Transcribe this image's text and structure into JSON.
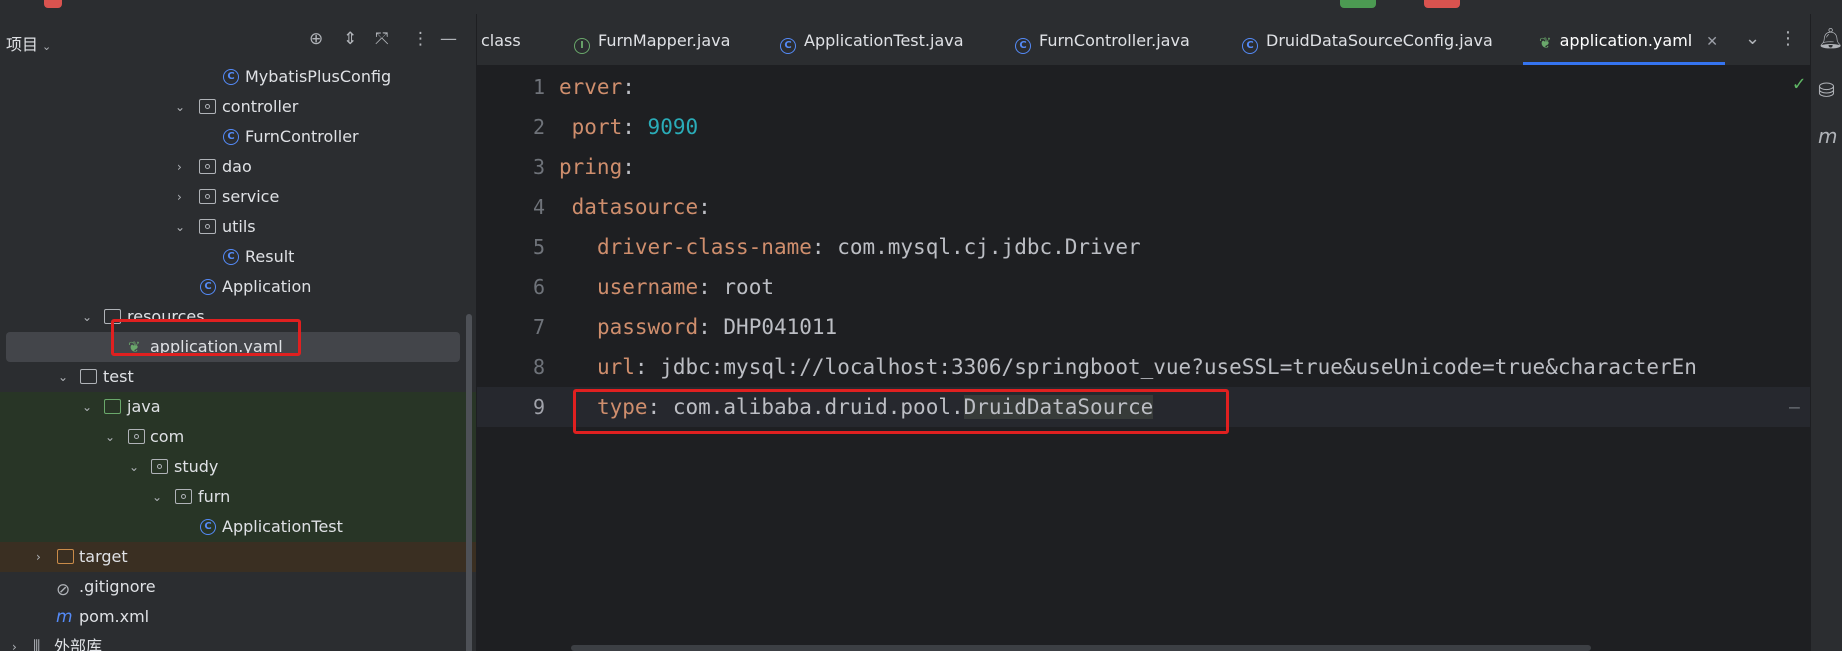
{
  "project_panel": {
    "title": "项目",
    "tree": [
      {
        "label": "MybatisPlusConfig",
        "type": "class"
      },
      {
        "label": "controller",
        "type": "package",
        "expanded": true
      },
      {
        "label": "FurnController",
        "type": "class"
      },
      {
        "label": "dao",
        "type": "package",
        "expanded": false
      },
      {
        "label": "service",
        "type": "package",
        "expanded": false
      },
      {
        "label": "utils",
        "type": "package",
        "expanded": true
      },
      {
        "label": "Result",
        "type": "class"
      },
      {
        "label": "Application",
        "type": "spring-class"
      },
      {
        "label": "resources",
        "type": "resources-folder",
        "expanded": true
      },
      {
        "label": "application.yaml",
        "type": "yaml",
        "selected": true
      },
      {
        "label": "test",
        "type": "folder",
        "expanded": true
      },
      {
        "label": "java",
        "type": "test-source-folder",
        "expanded": true
      },
      {
        "label": "com",
        "type": "package",
        "expanded": true
      },
      {
        "label": "study",
        "type": "package",
        "expanded": true
      },
      {
        "label": "furn",
        "type": "package",
        "expanded": true
      },
      {
        "label": "ApplicationTest",
        "type": "class"
      },
      {
        "label": "target",
        "type": "excluded-folder",
        "expanded": false
      },
      {
        "label": ".gitignore",
        "type": "ignore-file"
      },
      {
        "label": "pom.xml",
        "type": "maven-file"
      },
      {
        "label": "外部库",
        "type": "library",
        "expanded": false
      }
    ]
  },
  "tabs": [
    {
      "label": "class",
      "icon": "none",
      "active": false
    },
    {
      "label": "FurnMapper.java",
      "icon": "interface-icon",
      "active": false
    },
    {
      "label": "ApplicationTest.java",
      "icon": "class-icon",
      "active": false
    },
    {
      "label": "FurnController.java",
      "icon": "class-icon",
      "active": false
    },
    {
      "label": "DruidDataSourceConfig.java",
      "icon": "class-icon",
      "active": false
    },
    {
      "label": "application.yaml",
      "icon": "spring-yaml-icon",
      "active": true
    }
  ],
  "editor": {
    "current_line": 9,
    "lines": [
      {
        "num": "1",
        "indent": "",
        "key": "erver",
        "value": ""
      },
      {
        "num": "2",
        "indent": " ",
        "key": "port",
        "value": "9090"
      },
      {
        "num": "3",
        "indent": "",
        "key": "pring",
        "value": ""
      },
      {
        "num": "4",
        "indent": " ",
        "key": "datasource",
        "value": ""
      },
      {
        "num": "5",
        "indent": "   ",
        "key": "driver-class-name",
        "value": "com.mysql.cj.jdbc.Driver"
      },
      {
        "num": "6",
        "indent": "   ",
        "key": "username",
        "value": "root"
      },
      {
        "num": "7",
        "indent": "   ",
        "key": "password",
        "value": "DHP041011"
      },
      {
        "num": "8",
        "indent": "   ",
        "key": "url",
        "value": "jdbc:mysql://localhost:3306/springboot_vue?useSSL=true&useUnicode=true&characterEn"
      },
      {
        "num": "9",
        "indent": "   ",
        "key": "type",
        "value": "com.alibaba.druid.pool.",
        "value_highlight": "DruidDataSource"
      }
    ]
  },
  "colors": {
    "highlight_box": "#e02020",
    "accent": "#3574f0",
    "yaml_key": "#cf8e6d",
    "number": "#2aacb8"
  }
}
